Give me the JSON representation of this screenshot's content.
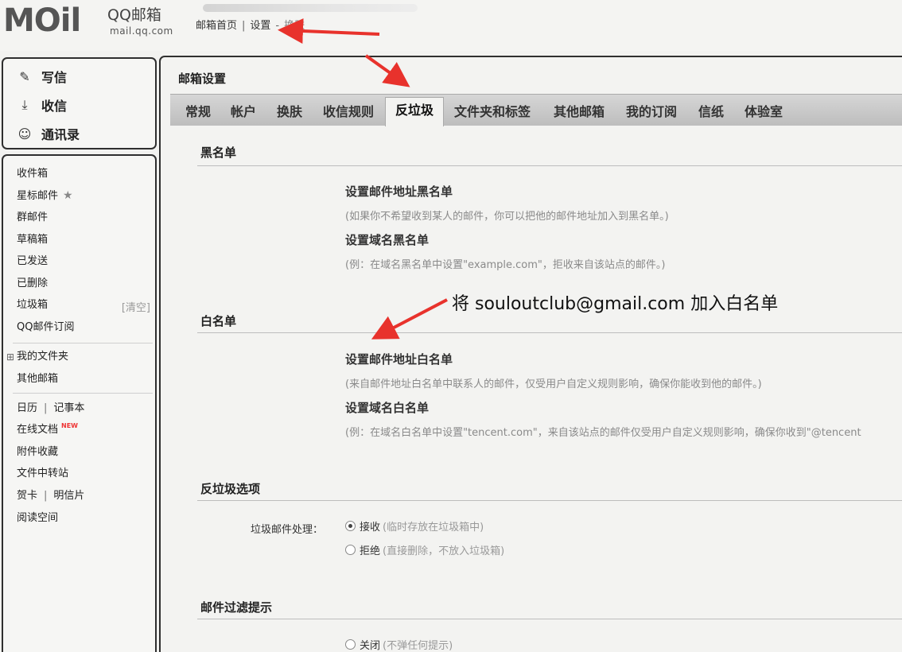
{
  "header": {
    "logo_mark": "MOil",
    "logo_cn": "QQ邮箱",
    "logo_domain": "mail.qq.com",
    "breadcrumb": [
      "邮箱首页",
      "设置",
      "换肤"
    ],
    "breadcrumb_sep": "|",
    "breadcrumb_sep2": "-"
  },
  "sidebar_top": {
    "items": [
      {
        "label": "写信",
        "icon": "pencil-icon"
      },
      {
        "label": "收信",
        "icon": "inbox-download-icon"
      },
      {
        "label": "通讯录",
        "icon": "contact-icon"
      }
    ]
  },
  "sidebar": {
    "folders": [
      "收件箱",
      "星标邮件",
      "群邮件",
      "草稿箱",
      "已发送",
      "已删除",
      "垃圾箱",
      "QQ邮件订阅"
    ],
    "clear_label": "[清空]",
    "my_folders": "我的文件夹",
    "other_mailbox": "其他邮箱",
    "calendar": "日历",
    "notepad": "记事本",
    "docs": "在线文档",
    "new_badge": "NEW",
    "attachments": "附件收藏",
    "file_transfer": "文件中转站",
    "greeting_card": "贺卡",
    "postcard": "明信片",
    "reading_space": "阅读空间",
    "pipe": "|",
    "folder_toggle": "⊞",
    "star_icon": "★"
  },
  "main": {
    "title": "邮箱设置",
    "tabs": [
      "常规",
      "帐户",
      "换肤",
      "收信规则",
      "反垃圾",
      "文件夹和标签",
      "其他邮箱",
      "我的订阅",
      "信纸",
      "体验室"
    ],
    "active_tab": "反垃圾",
    "blacklist": {
      "title": "黑名单",
      "addr_head": "设置邮件地址黑名单",
      "addr_desc": "(如果你不希望收到某人的邮件，你可以把他的邮件地址加入到黑名单。)",
      "domain_head": "设置域名黑名单",
      "domain_desc": "(例：在域名黑名单中设置\"example.com\"，拒收来自该站点的邮件。)"
    },
    "whitelist": {
      "title": "白名单",
      "addr_head": "设置邮件地址白名单",
      "addr_desc": "(来自邮件地址白名单中联系人的邮件，仅受用户自定义规则影响，确保你能收到他的邮件。)",
      "domain_head": "设置域名白名单",
      "domain_desc": "(例：在域名白名单中设置\"tencent.com\"，来自该站点的邮件仅受用户自定义规则影响，确保你收到\"@tencent"
    },
    "antispam": {
      "title": "反垃圾选项",
      "label": "垃圾邮件处理：",
      "accept": "接收",
      "accept_hint": "(临时存放在垃圾箱中)",
      "reject": "拒绝",
      "reject_hint": "(直接删除，不放入垃圾箱)"
    },
    "filter": {
      "title": "邮件过滤提示",
      "off": "关闭",
      "off_hint": "(不弹任何提示)"
    }
  },
  "annotation": {
    "text": "将 souloutclub@gmail.com 加入白名单",
    "arrow_color": "#e8322c"
  }
}
